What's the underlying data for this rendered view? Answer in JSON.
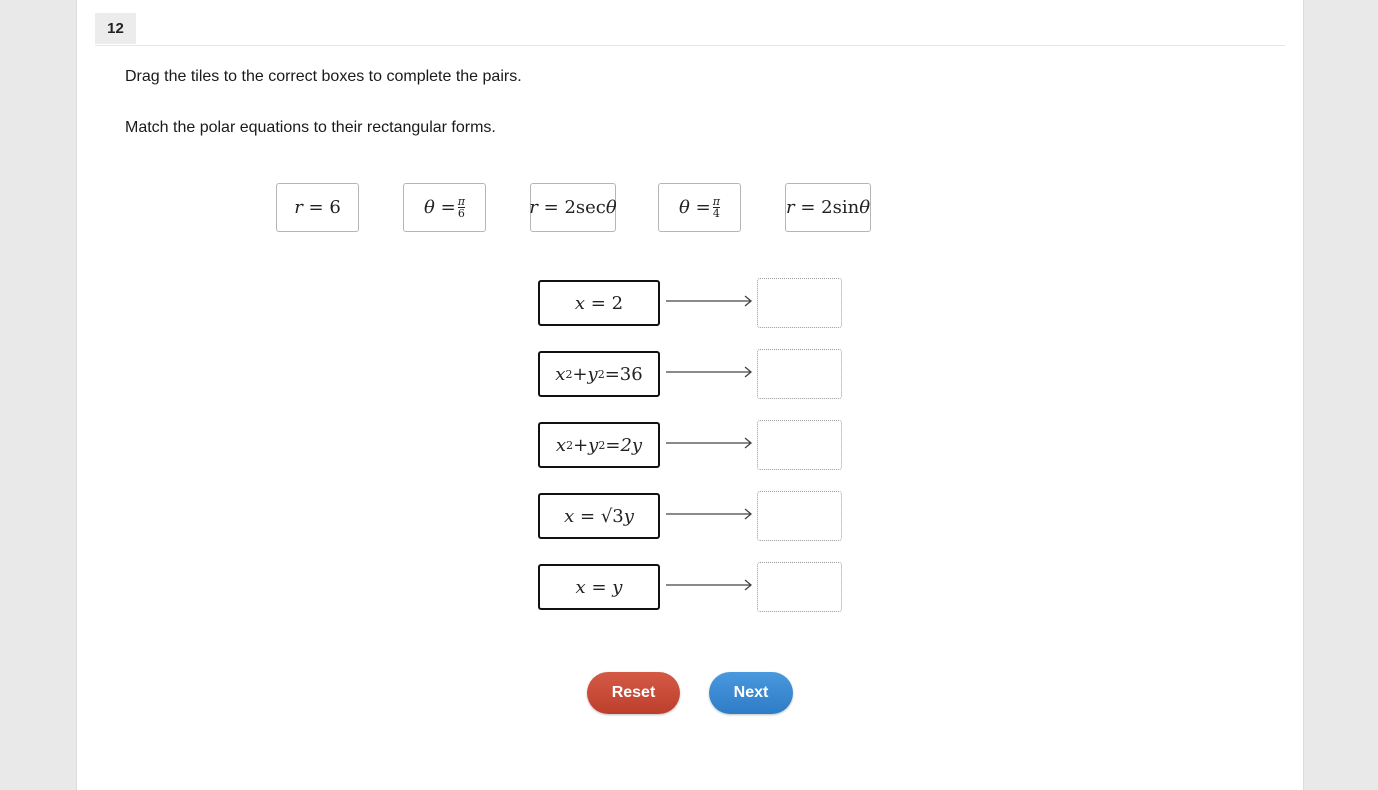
{
  "question": {
    "number": "12",
    "instruction": "Drag the tiles to the correct boxes to complete the pairs.",
    "prompt": "Match the polar equations to their rectangular forms."
  },
  "tiles": [
    {
      "lhs": "r",
      "eq": "=",
      "rhs": "6"
    },
    {
      "lhs": "θ",
      "eq": "=",
      "num": "π",
      "den": "6"
    },
    {
      "lhs": "r",
      "eq": "=",
      "rhs": "2sec",
      "var": "θ"
    },
    {
      "lhs": "θ",
      "eq": "=",
      "num": "π",
      "den": "4"
    },
    {
      "lhs": "r",
      "eq": "=",
      "rhs": "2sin",
      "var": "θ"
    }
  ],
  "pairs": [
    {
      "a": "x",
      "eq": "=",
      "b": "2"
    },
    {
      "a": "x",
      "exp1": "2",
      "plus": "+",
      "c": "y",
      "exp2": "2",
      "eq": "=",
      "b": "36"
    },
    {
      "a": "x",
      "exp1": "2",
      "plus": "+",
      "c": "y",
      "exp2": "2",
      "eq": "=",
      "b": "2y"
    },
    {
      "a": "x",
      "eq": "=",
      "b": "√3",
      "c": "y"
    },
    {
      "a": "x",
      "eq": "=",
      "b": "y"
    }
  ],
  "buttons": {
    "reset": "Reset",
    "next": "Next"
  },
  "colors": {
    "reset": "#c64b37",
    "next": "#3a89d2"
  }
}
